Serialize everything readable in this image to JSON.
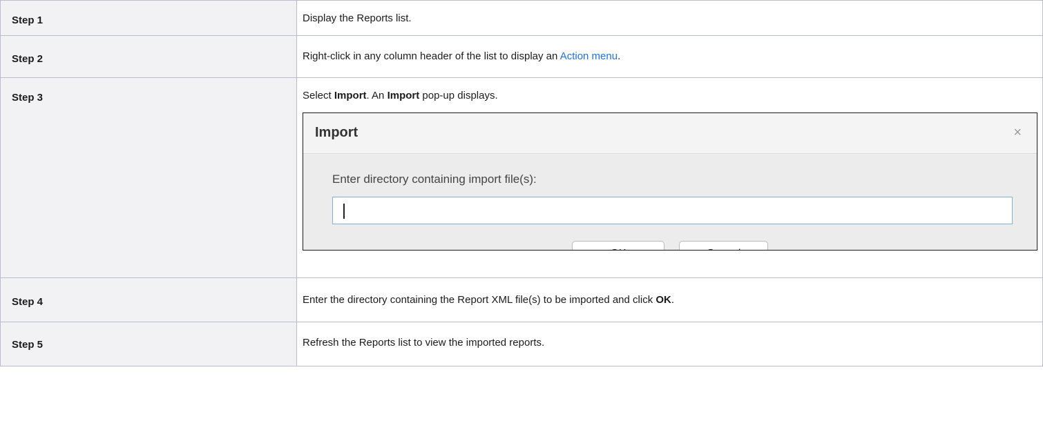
{
  "steps": [
    {
      "label": "Step 1",
      "text": "Display the Reports list."
    },
    {
      "label": "Step 2",
      "text_before": "Right-click in any column header of the list to display an ",
      "link": "Action menu",
      "text_after": "."
    },
    {
      "label": "Step 3",
      "text_part1": "Select ",
      "bold1": "Import",
      "text_part2": ". An ",
      "bold2": "Import",
      "text_part3": " pop-up displays."
    },
    {
      "label": "Step 4",
      "text_before": "Enter the directory containing the Report XML file(s) to be imported and click ",
      "bold": "OK",
      "text_after": "."
    },
    {
      "label": "Step 5",
      "text": "Refresh the Reports list to view the imported reports."
    }
  ],
  "dialog": {
    "title": "Import",
    "close_symbol": "×",
    "prompt": "Enter directory containing import file(s):",
    "input_value": "",
    "ok_label": "OK",
    "cancel_label": "Cancel"
  },
  "colors": {
    "link": "#1a73e8",
    "label_bg": "#f2f2f4",
    "border": "#b9bccc"
  }
}
